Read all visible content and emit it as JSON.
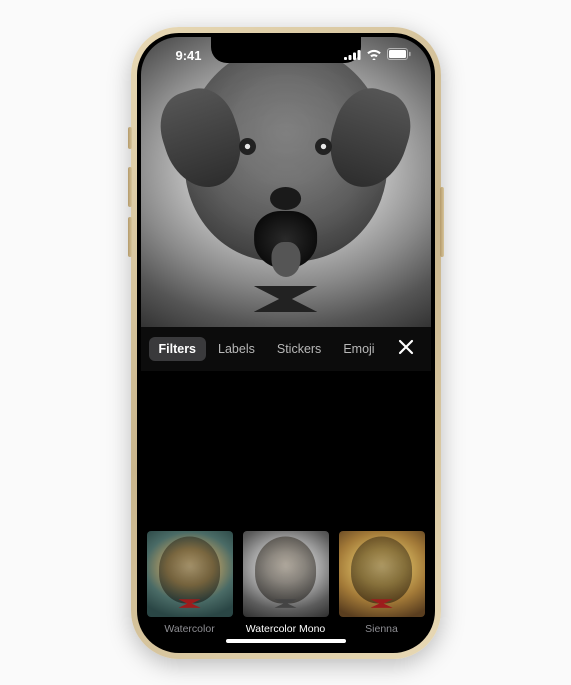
{
  "status_bar": {
    "time": "9:41",
    "signal_icon": "cellular-signal-icon",
    "wifi_icon": "wifi-icon",
    "battery_icon": "battery-icon"
  },
  "toolbar": {
    "tabs": [
      {
        "label": "Filters",
        "active": true
      },
      {
        "label": "Labels",
        "active": false
      },
      {
        "label": "Stickers",
        "active": false
      },
      {
        "label": "Emoji",
        "active": false
      }
    ],
    "close_icon": "close-icon"
  },
  "filters": [
    {
      "label": "Watercolor",
      "selected": false,
      "style": "watercolor"
    },
    {
      "label": "Watercolor Mono",
      "selected": true,
      "style": "mono"
    },
    {
      "label": "Sienna",
      "selected": false,
      "style": "sienna"
    }
  ]
}
